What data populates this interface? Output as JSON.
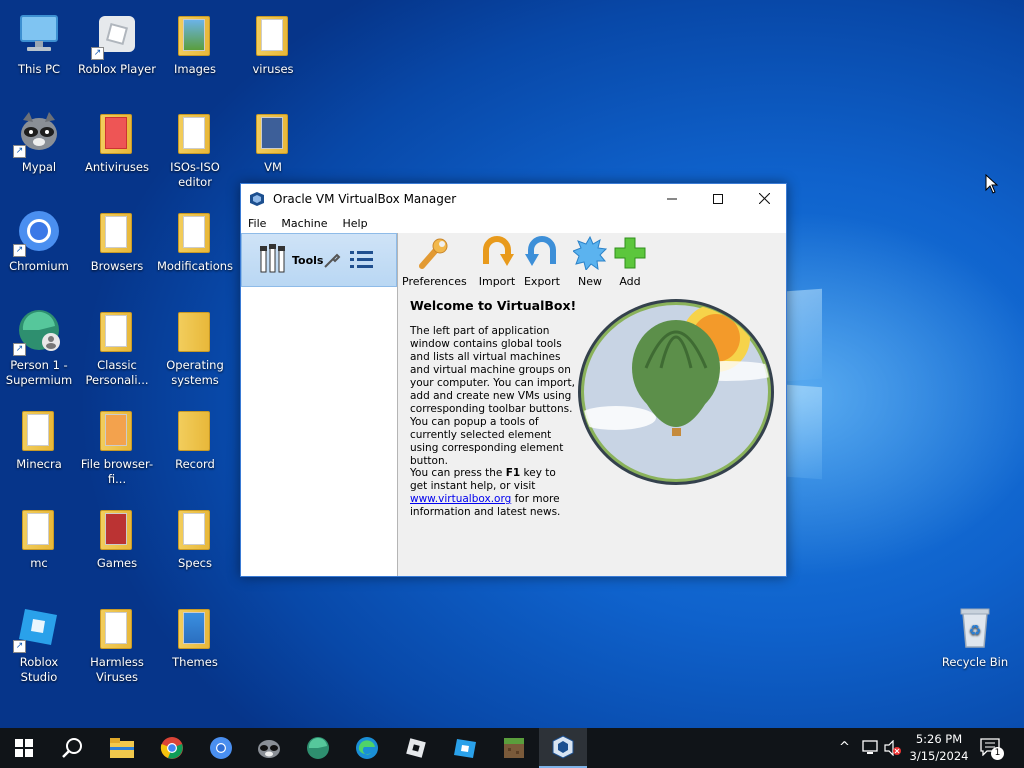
{
  "desktop": {
    "icons": [
      {
        "label": "This PC"
      },
      {
        "label": "Roblox Player"
      },
      {
        "label": "Images"
      },
      {
        "label": "viruses"
      },
      {
        "label": "Mypal"
      },
      {
        "label": "Antiviruses"
      },
      {
        "label": "ISOs-ISO editor"
      },
      {
        "label": "VM"
      },
      {
        "label": "Chromium"
      },
      {
        "label": "Browsers"
      },
      {
        "label": "Modifications"
      },
      {
        "label": "Person 1 - Supermium"
      },
      {
        "label": "Classic Personali..."
      },
      {
        "label": "Operating systems"
      },
      {
        "label": "Minecra"
      },
      {
        "label": "File browser-fi..."
      },
      {
        "label": "Record"
      },
      {
        "label": "mc"
      },
      {
        "label": "Games"
      },
      {
        "label": "Specs"
      },
      {
        "label": "Roblox Studio"
      },
      {
        "label": "Harmless Viruses"
      },
      {
        "label": "Themes"
      },
      {
        "label": "Recycle Bin"
      }
    ]
  },
  "vbox": {
    "title": "Oracle VM VirtualBox Manager",
    "menu": [
      "File",
      "Machine",
      "Help"
    ],
    "tools_label": "Tools",
    "toolbar": {
      "preferences": "Preferences",
      "import": "Import",
      "export": "Export",
      "new": "New",
      "add": "Add"
    },
    "welcome": {
      "title": "Welcome to VirtualBox!",
      "para1": "The left part of application window contains global tools and lists all virtual machines and virtual machine groups on your computer. You can import, add and create new VMs using corresponding toolbar buttons. You can popup a tools of currently selected element using corresponding element button.",
      "para2_before": "You can press the ",
      "para2_key": "F1",
      "para2_mid": " key to get instant help, or visit ",
      "para2_link": "www.virtualbox.org",
      "para2_after": " for more information and latest news."
    }
  },
  "taskbar": {
    "time": "5:26 PM",
    "date": "3/15/2024",
    "notification_count": "1"
  },
  "colors": {
    "accent": "#3a7bd5",
    "taskbar": "#101418",
    "desktop_blue": "#0f62cc"
  }
}
